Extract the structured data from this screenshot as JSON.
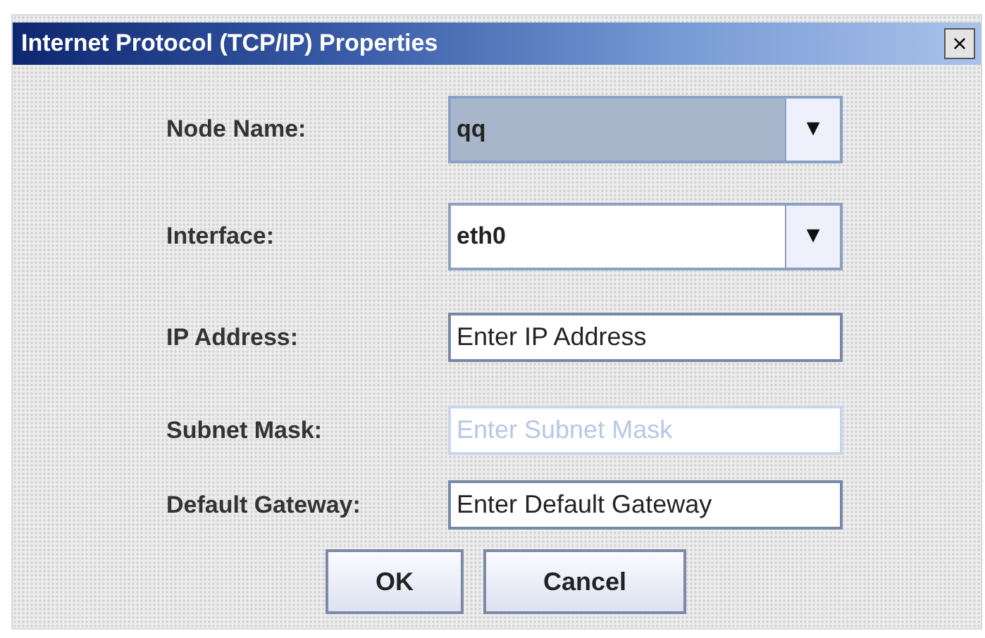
{
  "window": {
    "title": "Internet Protocol (TCP/IP) Properties",
    "close": "×"
  },
  "fields": [
    {
      "kind": "combo",
      "label": "Node Name:",
      "value": "qq",
      "focused": true,
      "arrow": "▼"
    },
    {
      "kind": "combo",
      "label": "Interface:",
      "value": "eth0",
      "focused": false,
      "arrow": "▼"
    },
    {
      "kind": "text",
      "label": "IP Address:",
      "value": "Enter IP Address",
      "disabled": false
    },
    {
      "kind": "text",
      "label": "Subnet Mask:",
      "value": "Enter Subnet Mask",
      "disabled": true
    },
    {
      "kind": "text",
      "label": "Default Gateway:",
      "value": "Enter Default Gateway",
      "disabled": false
    }
  ],
  "buttons": [
    "OK",
    "Cancel"
  ]
}
